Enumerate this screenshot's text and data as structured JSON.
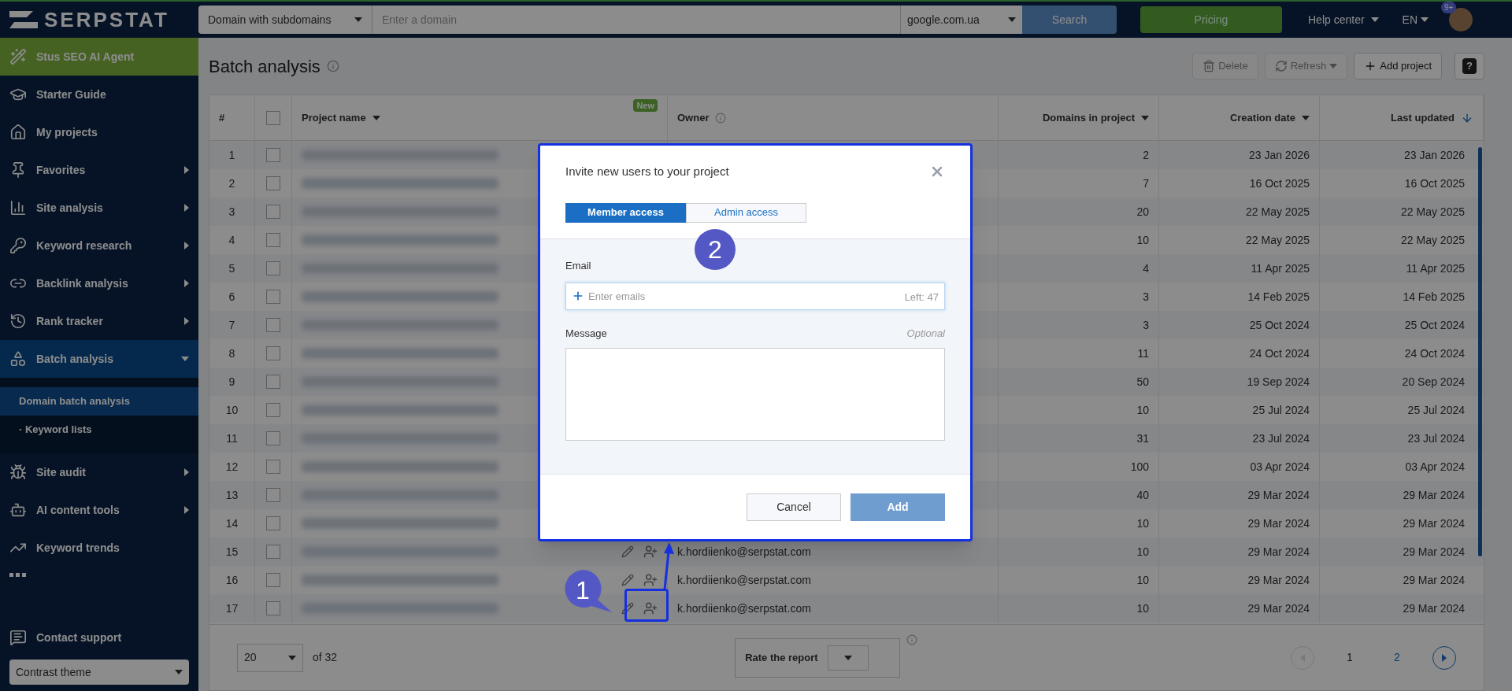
{
  "header": {
    "logo": "SERPSTAT",
    "search_type": "Domain with subdomains",
    "search_placeholder": "Enter a domain",
    "database": "google.com.ua",
    "search_button": {
      "label": "Search",
      "disabled": true
    },
    "pricing": "Pricing",
    "help": "Help center",
    "language": "EN",
    "notifications": "9+"
  },
  "sidebar": {
    "items": [
      {
        "label": "Stus SEO AI Agent",
        "kind": "promo",
        "submenu": false,
        "selected": false
      },
      {
        "label": "Starter Guide",
        "kind": "link",
        "submenu": false,
        "selected": false
      },
      {
        "label": "My projects",
        "kind": "link",
        "submenu": false,
        "selected": false
      },
      {
        "label": "Favorites",
        "kind": "link",
        "submenu": true,
        "expanded": false,
        "selected": false
      },
      {
        "label": "Site analysis",
        "kind": "link",
        "submenu": true,
        "expanded": false,
        "selected": false
      },
      {
        "label": "Keyword research",
        "kind": "link",
        "submenu": true,
        "expanded": false,
        "selected": false
      },
      {
        "label": "Backlink analysis",
        "kind": "link",
        "submenu": true,
        "expanded": false,
        "selected": false
      },
      {
        "label": "Rank tracker",
        "kind": "link",
        "submenu": true,
        "expanded": false,
        "selected": false
      },
      {
        "label": "Batch analysis",
        "kind": "link",
        "submenu": true,
        "expanded": true,
        "selected": true,
        "children": [
          {
            "label": "Domain batch analysis",
            "selected": true
          },
          {
            "label": "· Keyword lists",
            "selected": false
          }
        ]
      },
      {
        "label": "Site audit",
        "kind": "link",
        "submenu": true,
        "expanded": false,
        "selected": false
      },
      {
        "label": "AI content tools",
        "kind": "link",
        "submenu": true,
        "expanded": false,
        "selected": false
      },
      {
        "label": "Keyword trends",
        "kind": "link",
        "submenu": false,
        "selected": false
      }
    ],
    "contact": "Contact support",
    "theme": "Contrast theme"
  },
  "page": {
    "title": "Batch analysis",
    "toolbar": [
      {
        "label": "Delete",
        "kind": "delete",
        "disabled": true
      },
      {
        "label": "Refresh",
        "kind": "refresh",
        "disabled": true
      },
      {
        "label": "Add project",
        "kind": "add",
        "disabled": false
      },
      {
        "label": "?",
        "kind": "help",
        "disabled": false
      }
    ]
  },
  "table": {
    "columns": [
      {
        "label": "#",
        "kind": "plain"
      },
      {
        "kind": "checkbox",
        "checked": false
      },
      {
        "label": "Project name",
        "kind": "sortable",
        "badge": "New"
      },
      {
        "label": "Owner",
        "kind": "info"
      },
      {
        "label": "Domains in project",
        "kind": "sortable"
      },
      {
        "label": "Creation date",
        "kind": "sortable"
      },
      {
        "label": "Last updated",
        "kind": "sorted"
      }
    ],
    "rows": [
      {
        "number": "1",
        "checked": false,
        "domains": "2",
        "created": "23 Jan 2026",
        "updated": "23 Jan 2026"
      },
      {
        "number": "2",
        "checked": false,
        "domains": "7",
        "created": "16 Oct 2025",
        "updated": "16 Oct 2025"
      },
      {
        "number": "3",
        "checked": false,
        "domains": "20",
        "created": "22 May 2025",
        "updated": "22 May 2025"
      },
      {
        "number": "4",
        "checked": false,
        "domains": "10",
        "created": "22 May 2025",
        "updated": "22 May 2025"
      },
      {
        "number": "5",
        "checked": false,
        "domains": "4",
        "created": "11 Apr 2025",
        "updated": "11 Apr 2025"
      },
      {
        "number": "6",
        "checked": false,
        "domains": "3",
        "created": "14 Feb 2025",
        "updated": "14 Feb 2025"
      },
      {
        "number": "7",
        "checked": false,
        "domains": "3",
        "created": "25 Oct 2024",
        "updated": "25 Oct 2024"
      },
      {
        "number": "8",
        "checked": false,
        "domains": "11",
        "created": "24 Oct 2024",
        "updated": "24 Oct 2024"
      },
      {
        "number": "9",
        "checked": false,
        "domains": "50",
        "created": "19 Sep 2024",
        "updated": "20 Sep 2024"
      },
      {
        "number": "10",
        "checked": false,
        "domains": "10",
        "created": "25 Jul 2024",
        "updated": "25 Jul 2024"
      },
      {
        "number": "11",
        "checked": false,
        "domains": "31",
        "created": "23 Jul 2024",
        "updated": "23 Jul 2024"
      },
      {
        "number": "12",
        "checked": false,
        "domains": "100",
        "created": "03 Apr 2024",
        "updated": "03 Apr 2024"
      },
      {
        "number": "13",
        "checked": false,
        "domains": "40",
        "created": "29 Mar 2024",
        "updated": "29 Mar 2024"
      },
      {
        "number": "14",
        "checked": false,
        "domains": "10",
        "created": "29 Mar 2024",
        "updated": "29 Mar 2024"
      },
      {
        "number": "15",
        "checked": false,
        "owner": "k.hordiienko@serpstat.com",
        "domains": "10",
        "created": "29 Mar 2024",
        "updated": "29 Mar 2024"
      },
      {
        "number": "16",
        "checked": false,
        "owner": "k.hordiienko@serpstat.com",
        "domains": "10",
        "created": "29 Mar 2024",
        "updated": "29 Mar 2024"
      },
      {
        "number": "17",
        "checked": false,
        "owner": "k.hordiienko@serpstat.com",
        "domains": "10",
        "created": "29 Mar 2024",
        "updated": "29 Mar 2024"
      }
    ]
  },
  "footer": {
    "page_size": "20",
    "total": "of 32",
    "rate_label": "Rate the report",
    "prev_disabled": true,
    "next_disabled": false,
    "pages": [
      {
        "label": "1",
        "selected": true
      },
      {
        "label": "2",
        "selected": false
      }
    ]
  },
  "modal": {
    "title": "Invite new users to your project",
    "tabs": [
      {
        "label": "Member access",
        "selected": true
      },
      {
        "label": "Admin access",
        "selected": false
      }
    ],
    "email_label": "Email",
    "email_placeholder": "Enter emails",
    "left": "Left: 47",
    "message_label": "Message",
    "optional": "Optional",
    "cancel": "Cancel",
    "add": {
      "label": "Add",
      "disabled": true
    }
  },
  "annotations": [
    {
      "label": "2"
    },
    {
      "label": "1"
    }
  ]
}
